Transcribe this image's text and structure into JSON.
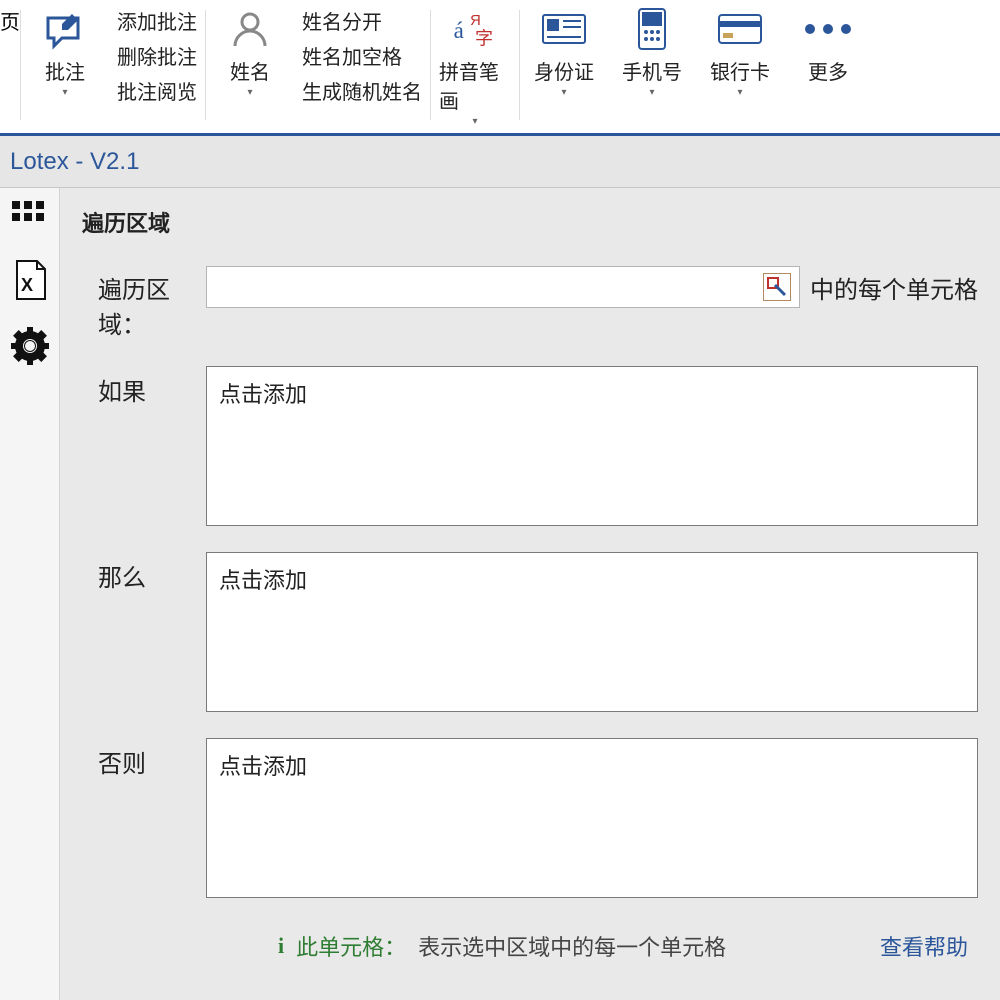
{
  "ribbon": {
    "partial_first": "页",
    "annotate": {
      "label": "批注",
      "items": [
        "添加批注",
        "删除批注",
        "批注阅览"
      ]
    },
    "name": {
      "label": "姓名",
      "items": [
        "姓名分开",
        "姓名加空格",
        "生成随机姓名"
      ]
    },
    "pinyin": {
      "label": "拼音笔画"
    },
    "idcard": {
      "label": "身份证"
    },
    "phone": {
      "label": "手机号"
    },
    "bankcard": {
      "label": "银行卡"
    },
    "more": {
      "label": "更多"
    }
  },
  "title": "Lotex - V2.1",
  "section_header": "遍历区域",
  "form": {
    "region_label": "遍历区域：",
    "region_value": "",
    "region_suffix": "中的每个单元格",
    "if_label": "如果",
    "if_placeholder": "点击添加",
    "then_label": "那么",
    "then_placeholder": "点击添加",
    "else_label": "否则",
    "else_placeholder": "点击添加"
  },
  "footer": {
    "info_char": "i",
    "hint_label": "此单元格：",
    "hint_text": "表示选中区域中的每一个单元格",
    "help_link": "查看帮助"
  }
}
